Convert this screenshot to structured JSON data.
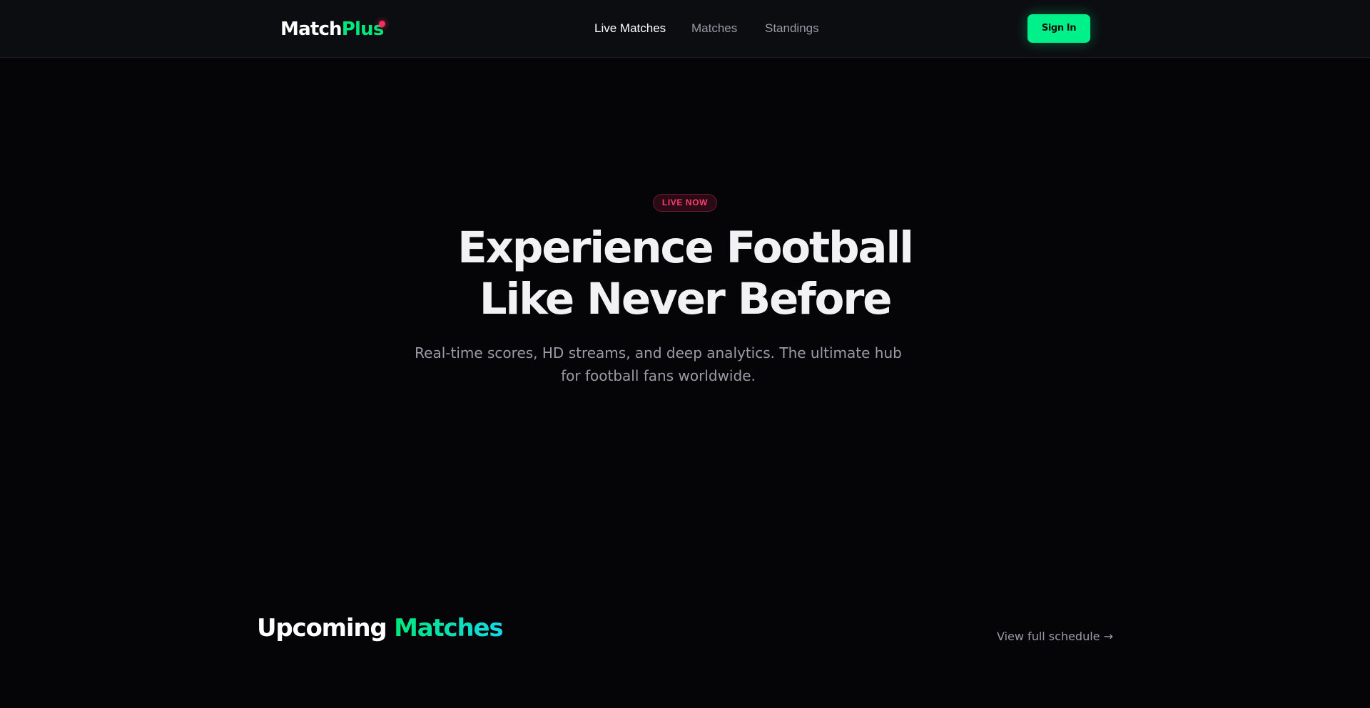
{
  "header": {
    "logo": {
      "primary": "Match",
      "accent": "Plus"
    },
    "nav": [
      {
        "label": "Live Matches",
        "active": true
      },
      {
        "label": "Matches",
        "active": false
      },
      {
        "label": "Standings",
        "active": false
      }
    ],
    "signin_label": "Sign In"
  },
  "hero": {
    "badge": "LIVE NOW",
    "title_line1": "Experience Football",
    "title_line2": "Like Never Before",
    "subtitle_line1": "Real-time scores, HD streams, and deep analytics. The ultimate hub",
    "subtitle_line2": "for football fans worldwide."
  },
  "upcoming": {
    "title_primary": "Upcoming",
    "title_accent": "Matches",
    "schedule_link": "View full schedule →"
  },
  "colors": {
    "background": "#050507",
    "header_background": "#0c0d10",
    "brand_green": "#00f08a",
    "accent_cyan": "#14d8e8",
    "live_red": "#ff2a5f",
    "muted_text": "#9c9ca8"
  }
}
